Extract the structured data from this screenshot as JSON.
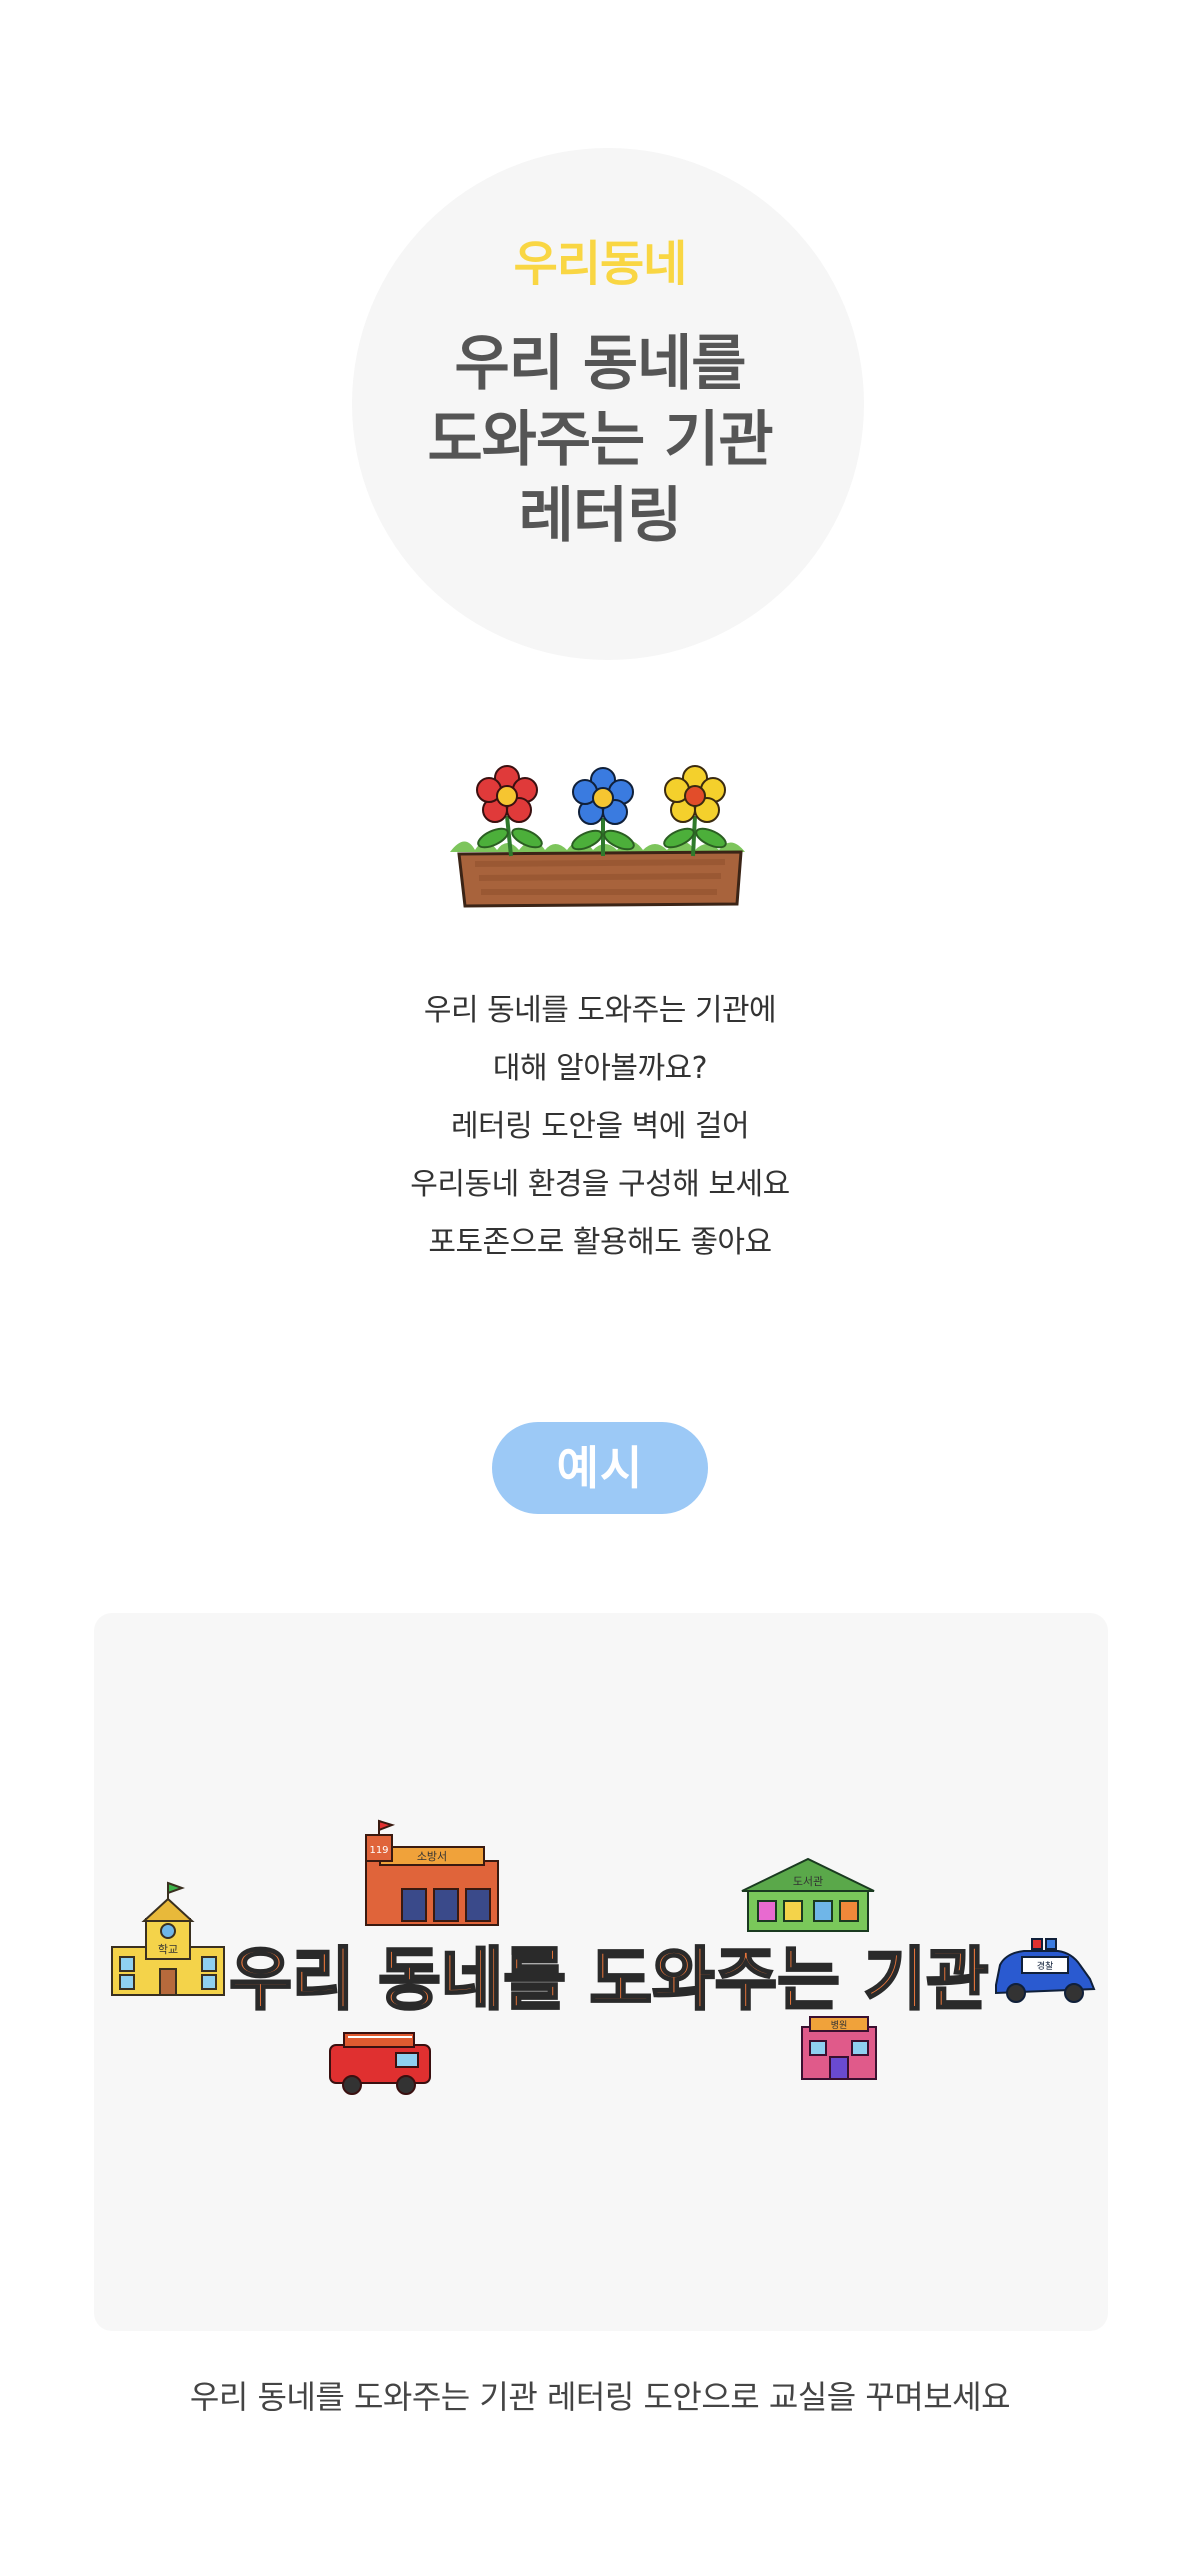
{
  "hero": {
    "category": "우리동네",
    "title_lines": [
      "우리 동네를",
      "도와주는 기관",
      "레터링"
    ]
  },
  "intro": {
    "lines": [
      "우리 동네를 도와주는 기관에",
      "대해 알아볼까요?",
      "레터링 도안을 벽에 걸어",
      "우리동네 환경을 구성해 보세요",
      "포토존으로 활용해도 좋아요"
    ]
  },
  "example": {
    "label": "예시",
    "lettering": "우리 동네를 도와주는 기관",
    "building_labels": {
      "school": "학교",
      "fire_station": "소방서",
      "fire_station_number": "119",
      "library": "도서관",
      "hospital": "병원",
      "police": "경찰"
    }
  },
  "caption": "우리 동네를 도와주는 기관 레터링 도안으로 교실을 꾸며보세요",
  "colors": {
    "category_yellow": "#f9d643",
    "title_gray": "#555555",
    "pill_blue": "#9cc9f6",
    "panel_bg": "#f7f7f7",
    "circle_bg": "#f6f6f6"
  }
}
